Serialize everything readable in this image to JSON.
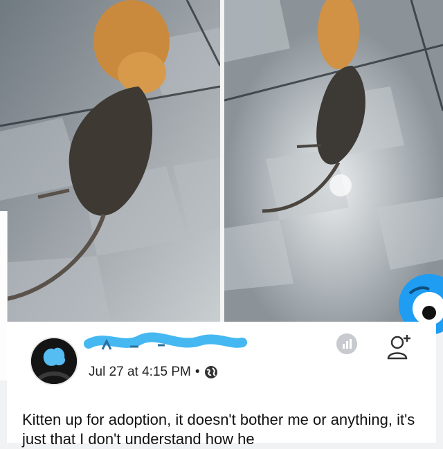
{
  "post": {
    "timestamp": "Jul 27 at 4:15 PM",
    "separator": "•",
    "text": "Kitten up for adoption, it doesn't bother me or anything, it's just that I don't understand how he",
    "icons": {
      "globe": "globe-icon",
      "stats": "stats-icon",
      "add_friend": "add-friend-icon",
      "avatar": "avatar",
      "reaction": "blue-emoji-icon"
    }
  },
  "colors": {
    "floor_light": "#d8dcdf",
    "floor_dark": "#8e959b",
    "name_scribble": "#45b8f2",
    "emoji_blue": "#1e9df2"
  }
}
